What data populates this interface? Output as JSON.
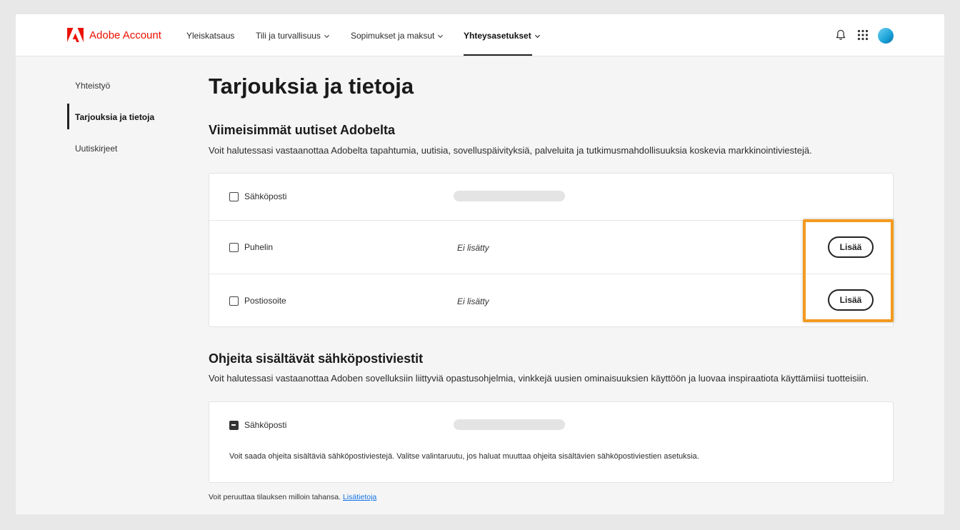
{
  "header": {
    "brand": "Adobe Account",
    "nav": [
      {
        "label": "Yleiskatsaus",
        "has_menu": false
      },
      {
        "label": "Tili ja turvallisuus",
        "has_menu": true
      },
      {
        "label": "Sopimukset ja maksut",
        "has_menu": true
      },
      {
        "label": "Yhteysasetukset",
        "has_menu": true,
        "active": true
      }
    ],
    "icons": [
      "bell-icon",
      "apps-grid-icon",
      "avatar"
    ]
  },
  "sidebar": {
    "items": [
      {
        "label": "Yhteistyö"
      },
      {
        "label": "Tarjouksia ja tietoja",
        "active": true
      },
      {
        "label": "Uutiskirjeet"
      }
    ]
  },
  "main": {
    "title": "Tarjouksia ja tietoja",
    "news": {
      "title": "Viimeisimmät uutiset Adobelta",
      "description": "Voit halutessasi vastaanottaa Adobelta tapahtumia, uutisia, sovelluspäivityksiä, palveluita ja tutkimusmahdollisuuksia koskevia markkinointiviestejä.",
      "rows": [
        {
          "label": "Sähköposti",
          "checked": false
        },
        {
          "label": "Puhelin",
          "value": "Ei lisätty",
          "button": "Lisää",
          "checked": false
        },
        {
          "label": "Postiosoite",
          "value": "Ei lisätty",
          "button": "Lisää",
          "checked": false
        }
      ]
    },
    "tutorials": {
      "title": "Ohjeita sisältävät sähköpostiviestit",
      "description": "Voit halutessasi vastaanottaa Adoben sovelluksiin liittyviä opastusohjelmia, vinkkejä uusien ominaisuuksien käyttöön ja luovaa inspiraatiota käyttämiisi tuotteisiin.",
      "row": {
        "label": "Sähköposti",
        "state": "indeterminate"
      },
      "note": "Voit saada ohjeita sisältäviä sähköpostiviestejä. Valitse valintaruutu, jos haluat muuttaa ohjeita sisältävien sähköpostiviestien asetuksia."
    },
    "footer": {
      "text": "Voit peruuttaa tilauksen milloin tahansa.",
      "link": "Lisätietoja"
    }
  },
  "colors": {
    "brand_red": "#eb1000",
    "highlight_orange": "#f39a1e",
    "link_blue": "#1473e6"
  }
}
